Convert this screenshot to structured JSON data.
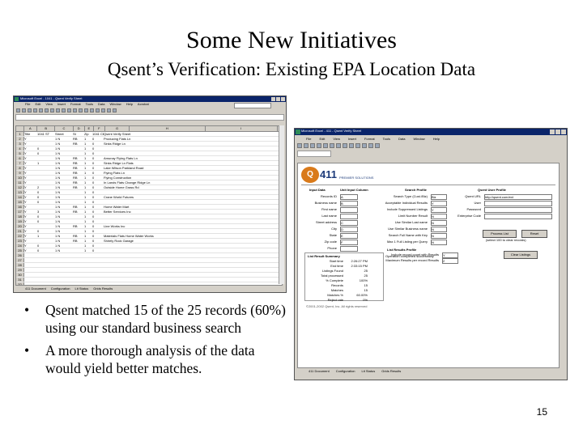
{
  "slide": {
    "title": "Some New Initiatives",
    "subtitle": "Qsent’s Verification: Existing EPA Location Data",
    "bullets": [
      "Qsent matched 15 of the 25 records (60%) using our standard business search",
      "A more thorough analysis of the data would yield better matches."
    ],
    "bullet_glyph": "•",
    "page_number": "15"
  },
  "left_window": {
    "title": "Microsoft Excel - 1041 - Qsent Verify Sheet",
    "menu": [
      "File",
      "Edit",
      "View",
      "Insert",
      "Format",
      "Tools",
      "Data",
      "Window",
      "Help",
      "Acrobat"
    ],
    "columns": [
      "",
      "A",
      "B",
      "C",
      "D",
      "E",
      "F",
      "G",
      "H",
      "I",
      "J"
    ],
    "rows": [
      [
        "1",
        "Title",
        "1041 ST",
        "Street",
        "St",
        "Zip",
        "1041 CE",
        "Qsent Verify Sheet",
        ""
      ],
      [
        "2",
        "Y",
        "",
        "1 N",
        "RB",
        "1",
        "0",
        "Producing Flats Ln",
        ""
      ],
      [
        "3",
        "Y",
        "",
        "1 N",
        "RB",
        "1",
        "0",
        "Sinks Ridge Ln",
        ""
      ],
      [
        "4",
        "Y",
        "0",
        "1 N",
        "",
        "1",
        "0",
        "",
        ""
      ],
      [
        "5",
        "Y",
        "0",
        "1 N",
        "",
        "1",
        "0",
        "",
        ""
      ],
      [
        "6",
        "Y",
        "",
        "1 N",
        "RB",
        "1",
        "0",
        "Amunay Flying Flats Ln",
        ""
      ],
      [
        "7",
        "Y",
        "1",
        "1 N",
        "RB",
        "1",
        "0",
        "Sinks Ridge Ln Flats",
        ""
      ],
      [
        "8",
        "Y",
        "",
        "1 N",
        "RB",
        "1",
        "0",
        "Lake Wilson Parkland Road",
        ""
      ],
      [
        "9",
        "Y",
        "",
        "1 N",
        "RB",
        "1",
        "0",
        "Flying Flats Ln",
        ""
      ],
      [
        "10",
        "Y",
        "",
        "1 N",
        "RB",
        "1",
        "0",
        "Flying Construction",
        ""
      ],
      [
        "11",
        "Y",
        "",
        "1 N",
        "RB",
        "1",
        "0",
        "In Lands Flats Change Ridge Ln",
        ""
      ],
      [
        "12",
        "Y",
        "2",
        "1 N",
        "RB",
        "1",
        "0",
        "Outside Home Grass Rd",
        ""
      ],
      [
        "13",
        "Y",
        "0",
        "1 N",
        "",
        "1",
        "0",
        "",
        ""
      ],
      [
        "14",
        "Y",
        "0",
        "1 N",
        "",
        "1",
        "0",
        "Crane World Futures",
        ""
      ],
      [
        "15",
        "Y",
        "0",
        "1 N",
        "",
        "1",
        "0",
        "",
        ""
      ],
      [
        "16",
        "Y",
        "",
        "1 N",
        "RB",
        "1",
        "0",
        "Home Water Mart",
        ""
      ],
      [
        "17",
        "Y",
        "3",
        "1 N",
        "RB",
        "1",
        "0",
        "Better Services Inc",
        ""
      ],
      [
        "18",
        "Y",
        "0",
        "1 N",
        "",
        "1",
        "0",
        "",
        ""
      ],
      [
        "19",
        "Y",
        "0",
        "1 N",
        "",
        "1",
        "0",
        "",
        ""
      ],
      [
        "20",
        "Y",
        "",
        "1 N",
        "RB",
        "1",
        "0",
        "Line Works Inc",
        ""
      ],
      [
        "21",
        "Y",
        "0",
        "1 N",
        "",
        "1",
        "0",
        "",
        ""
      ],
      [
        "22",
        "Y",
        "1",
        "1 N",
        "RB",
        "1",
        "0",
        "Materials Flats Home Water Works",
        ""
      ],
      [
        "23",
        "Y",
        "",
        "1 N",
        "RB",
        "1",
        "0",
        "Shirely Rock Garage",
        ""
      ],
      [
        "24",
        "Y",
        "0",
        "1 N",
        "",
        "1",
        "0",
        "",
        ""
      ],
      [
        "25",
        "Y",
        "0",
        "1 N",
        "",
        "1",
        "0",
        "",
        ""
      ],
      [
        "26",
        "",
        "",
        "",
        "",
        "",
        "",
        "",
        ""
      ],
      [
        "27",
        "",
        "",
        "",
        "",
        "",
        "",
        "",
        ""
      ],
      [
        "28",
        "",
        "",
        "",
        "",
        "",
        "",
        "",
        ""
      ],
      [
        "29",
        "",
        "",
        "",
        "",
        "",
        "",
        "",
        ""
      ],
      [
        "30",
        "",
        "",
        "",
        "",
        "",
        "",
        "",
        ""
      ],
      [
        "31",
        "",
        "",
        "",
        "",
        "",
        "",
        "",
        ""
      ],
      [
        "32",
        "",
        "",
        "",
        "",
        "",
        "",
        "",
        ""
      ],
      [
        "33",
        "",
        "",
        "",
        "",
        "",
        "",
        "",
        ""
      ],
      [
        "34",
        "",
        "",
        "",
        "",
        "",
        "",
        "",
        ""
      ],
      [
        "35",
        "",
        "",
        "",
        "",
        "",
        "",
        "",
        ""
      ],
      [
        "36",
        "",
        "",
        "",
        "",
        "",
        "",
        "",
        ""
      ]
    ],
    "sheet_tabs": [
      "411 Document",
      "Configuration",
      "Lit Status",
      "Grids Results"
    ]
  },
  "right_window": {
    "title": "Microsoft Excel - 411 - Qsent Verify Sheet",
    "menu": [
      "File",
      "Edit",
      "View",
      "Insert",
      "Format",
      "Tools",
      "Data",
      "Window",
      "Help"
    ],
    "logo_mark": "Q",
    "logo_number": "411",
    "logo_tagline": "PREMIER SOLUTIONS",
    "headers": {
      "input_data": "Input Data",
      "unit_output": "Unit Input Column",
      "search_profile": "Search Profile",
      "user_profile": "Qsent User Profile"
    },
    "input_fields": [
      "Records ID",
      "Business name",
      "First name",
      "Last name",
      "Street address",
      "City",
      "State",
      "Zip code",
      "Phone"
    ],
    "input_values": [
      "A",
      "B",
      "",
      "",
      "C",
      "D",
      "E",
      "F",
      ""
    ],
    "search_fields": [
      "Search Type (Cust./Biz)",
      "Acceptable Individual Results",
      "Include Suppressed Listings",
      "Limit Number Result",
      "Use Similar Last name",
      "Use Similar Business name",
      "Search Full Name with Key",
      "Max 1 Full Listing per Query"
    ],
    "search_values": [
      "Biz",
      "Y",
      "Y",
      "N",
      "N",
      "N",
      "N",
      "N"
    ],
    "user_fields": [
      "Qsent URL",
      "User",
      "Password",
      "Enterprise Code"
    ],
    "user_values": [
      "http://qsent.com/ext",
      "",
      "",
      ""
    ],
    "buttons": {
      "process": "Process List",
      "reset": "Reset",
      "note": "(select 100 to clear records)",
      "clear": "Clear Listings"
    },
    "list_profile": {
      "title": "List Results Profile",
      "rows": [
        "Include record count with Results",
        "Maximum Results per record Results"
      ],
      "values": [
        "Y",
        "2"
      ]
    },
    "summary": {
      "title": "List Result Summary",
      "rows": [
        [
          "Start time",
          "2:26:27 PM"
        ],
        [
          "End time",
          "2:33:15 PM"
        ],
        [
          "Listings Found",
          "25"
        ],
        [
          "Total processed",
          "25"
        ],
        [
          "% Complete",
          "100%"
        ],
        [
          "Records",
          "15"
        ],
        [
          "Matches",
          "15"
        ],
        [
          "Matches %",
          "60.00%"
        ],
        [
          "Reject rate",
          "0%"
        ]
      ],
      "status": "Operation completed successfully"
    },
    "copyright": "©2001-2002 Qsent, Inc. All rights reserved",
    "sheet_tabs": [
      "411 Document",
      "Configuration",
      "Lit Status",
      "Grids Results"
    ]
  }
}
